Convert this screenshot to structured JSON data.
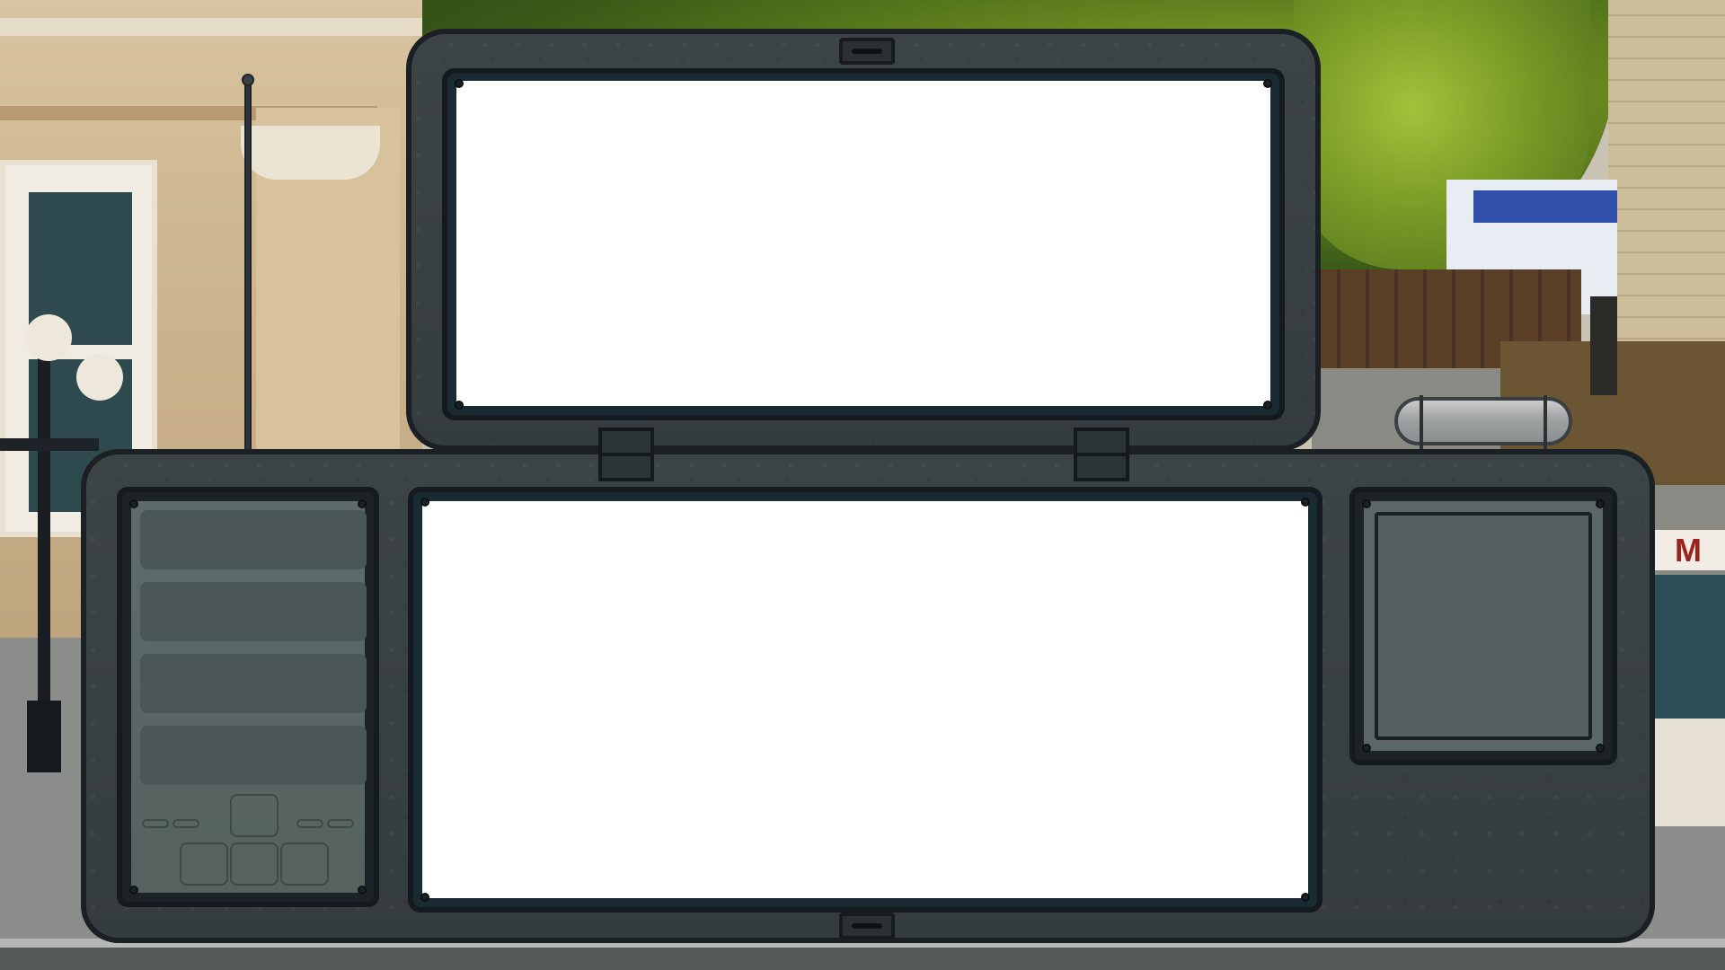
{
  "scene": {
    "shop_sign_text": "M"
  },
  "device": {
    "top_screen": {
      "content": ""
    },
    "main_screen": {
      "content": ""
    },
    "side_panel": {
      "content": ""
    }
  },
  "icons": [
    "antenna-icon",
    "capsule-icon",
    "hinge-icon",
    "slot-icon",
    "dpad-icon"
  ]
}
